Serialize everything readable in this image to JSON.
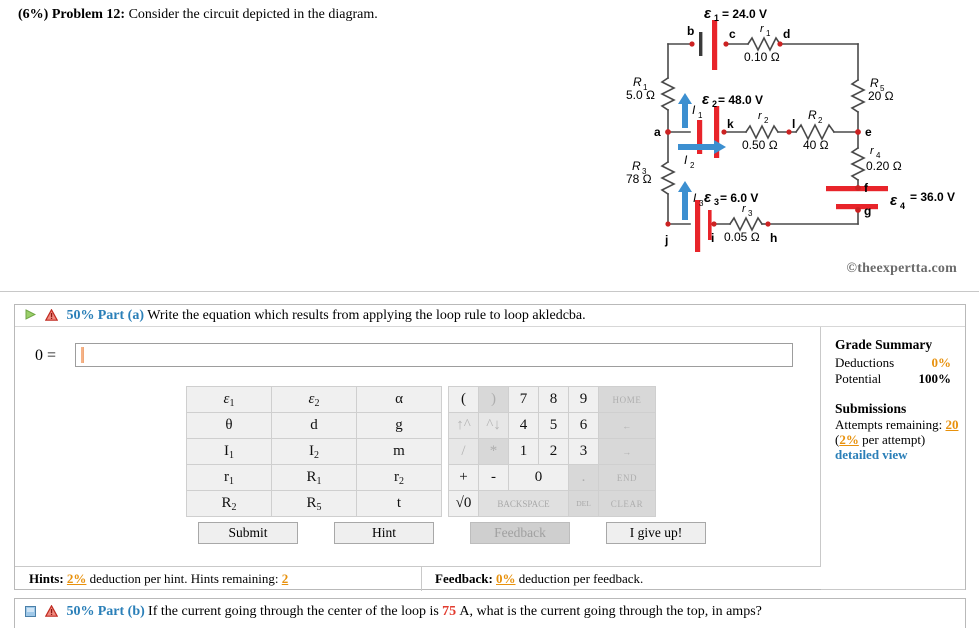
{
  "problem": {
    "weight": "(6%)",
    "label": "Problem 12:",
    "text": "Consider the circuit depicted in the diagram."
  },
  "credit": "©theexpertta.com",
  "circuit": {
    "sources": [
      {
        "name": "ε1",
        "value": "= 24.0 V"
      },
      {
        "name": "ε2",
        "value": "= 48.0 V"
      },
      {
        "name": "ε3",
        "value": "= 6.0 V"
      },
      {
        "name": "ε4",
        "value": "= 36.0 V"
      }
    ],
    "resistors": [
      {
        "name": "R1",
        "value": "5.0 Ω"
      },
      {
        "name": "R2",
        "value": "40 Ω"
      },
      {
        "name": "R3",
        "value": "78 Ω"
      },
      {
        "name": "R5",
        "value": "20 Ω"
      },
      {
        "name": "r1",
        "value": "0.10 Ω"
      },
      {
        "name": "r2",
        "value": "0.50 Ω"
      },
      {
        "name": "r3",
        "value": "0.05 Ω"
      },
      {
        "name": "r4",
        "value": "0.20 Ω"
      }
    ],
    "currents": [
      "I1",
      "I2",
      "I3"
    ],
    "nodes": [
      "a",
      "b",
      "c",
      "d",
      "e",
      "f",
      "g",
      "h",
      "i",
      "j",
      "k",
      "l"
    ],
    "labels": {
      "eps1": "ε",
      "eps1_sub": "1",
      "eps1_val": "= 24.0 V",
      "eps2": "ε",
      "eps2_sub": "2",
      "eps2_val": "= 48.0 V",
      "eps3": "ε",
      "eps3_sub": "3",
      "eps3_val": "= 6.0 V",
      "eps4": "ε",
      "eps4_sub": "4",
      "eps4_val": "= 36.0 V",
      "R1": "R",
      "R1_sub": "1",
      "R1_val": "5.0 Ω",
      "R2": "R",
      "R2_sub": "2",
      "R2_val": "40 Ω",
      "R3": "R",
      "R3_sub": "3",
      "R3_val": "78 Ω",
      "R5": "R",
      "R5_sub": "5",
      "R5_val": "20 Ω",
      "r1": "r",
      "r1_sub": "1",
      "r1_val": "0.10 Ω",
      "r2": "r",
      "r2_sub": "2",
      "r2_val": "0.50 Ω",
      "r3": "r",
      "r3_sub": "3",
      "r3_val": "0.05 Ω",
      "r4": "r",
      "r4_sub": "4",
      "r4_val": "0.20 Ω"
    }
  },
  "part_a": {
    "percent": "50%",
    "name": "Part (a)",
    "prompt": "Write the equation which results from applying the loop rule to loop akledcba.",
    "equation_label": "0 =",
    "answer_value": "",
    "answer_placeholder": ""
  },
  "keypad": {
    "left_rows": [
      [
        {
          "t": "ε",
          "s": "1",
          "it": true
        },
        {
          "t": "ε",
          "s": "2",
          "it": true
        },
        {
          "t": "α",
          "s": "",
          "it": false
        }
      ],
      [
        {
          "t": "θ",
          "s": "",
          "it": false
        },
        {
          "t": "d",
          "s": "",
          "it": false
        },
        {
          "t": "g",
          "s": "",
          "it": false
        }
      ],
      [
        {
          "t": "I",
          "s": "1",
          "it": false
        },
        {
          "t": "I",
          "s": "2",
          "it": false
        },
        {
          "t": "m",
          "s": "",
          "it": false
        }
      ],
      [
        {
          "t": "r",
          "s": "1",
          "it": false
        },
        {
          "t": "R",
          "s": "1",
          "it": false
        },
        {
          "t": "r",
          "s": "2",
          "it": false
        }
      ],
      [
        {
          "t": "R",
          "s": "2",
          "it": false
        },
        {
          "t": "R",
          "s": "5",
          "it": false
        },
        {
          "t": "t",
          "s": "",
          "it": false
        }
      ]
    ],
    "right_rows": [
      [
        {
          "t": "(",
          "k": "n"
        },
        {
          "t": ")",
          "k": "d"
        },
        {
          "t": "7",
          "k": "n"
        },
        {
          "t": "8",
          "k": "n"
        },
        {
          "t": "9",
          "k": "n"
        },
        {
          "t": "HOME",
          "k": "fn"
        }
      ],
      [
        {
          "t": "↑^",
          "k": "dl"
        },
        {
          "t": "^↓",
          "k": "dl"
        },
        {
          "t": "4",
          "k": "n"
        },
        {
          "t": "5",
          "k": "n"
        },
        {
          "t": "6",
          "k": "n"
        },
        {
          "t": "←",
          "k": "fn"
        }
      ],
      [
        {
          "t": "/",
          "k": "dl"
        },
        {
          "t": "*",
          "k": "d"
        },
        {
          "t": "1",
          "k": "n"
        },
        {
          "t": "2",
          "k": "n"
        },
        {
          "t": "3",
          "k": "n"
        },
        {
          "t": "→",
          "k": "fn"
        }
      ],
      [
        {
          "t": "+",
          "k": "n"
        },
        {
          "t": "-",
          "k": "n"
        },
        {
          "t": "0",
          "k": "wide"
        },
        {
          "t": ".",
          "k": "d"
        },
        {
          "t": "END",
          "k": "fn"
        }
      ],
      [
        {
          "t": "√0",
          "k": "n"
        },
        {
          "t": "BACKSPACE",
          "k": "bk"
        },
        {
          "t": "DEL",
          "k": "del"
        },
        {
          "t": "CLEAR",
          "k": "fn"
        }
      ]
    ]
  },
  "buttons": {
    "submit": "Submit",
    "hint": "Hint",
    "feedback": "Feedback",
    "giveup": "I give up!"
  },
  "hints_bar": {
    "hints_label": "Hints:",
    "hints_pct": "2%",
    "hints_text": "deduction per hint. Hints remaining:",
    "hints_remaining": "2",
    "feedback_label": "Feedback:",
    "feedback_pct": "0%",
    "feedback_text": "deduction per feedback."
  },
  "grade_summary": {
    "title": "Grade Summary",
    "deductions_label": "Deductions",
    "deductions_value": "0%",
    "potential_label": "Potential",
    "potential_value": "100%",
    "submissions_title": "Submissions",
    "attempts_label": "Attempts remaining:",
    "attempts_value": "20",
    "per_attempt_pct": "2%",
    "per_attempt_text": "per attempt)",
    "per_attempt_open": "(",
    "detailed_view": "detailed view"
  },
  "part_b": {
    "percent": "50%",
    "name": "Part (b)",
    "prompt_1": "If the current going through the center of the loop is",
    "value": "75",
    "prompt_2": "A, what is the current going through the top, in amps?"
  },
  "colors": {
    "accent_blue": "#2a7fb8",
    "orange": "#e8910c",
    "red": "#e23b2e",
    "battery_red": "#e8242a",
    "current_blue": "#3c8fd0"
  }
}
